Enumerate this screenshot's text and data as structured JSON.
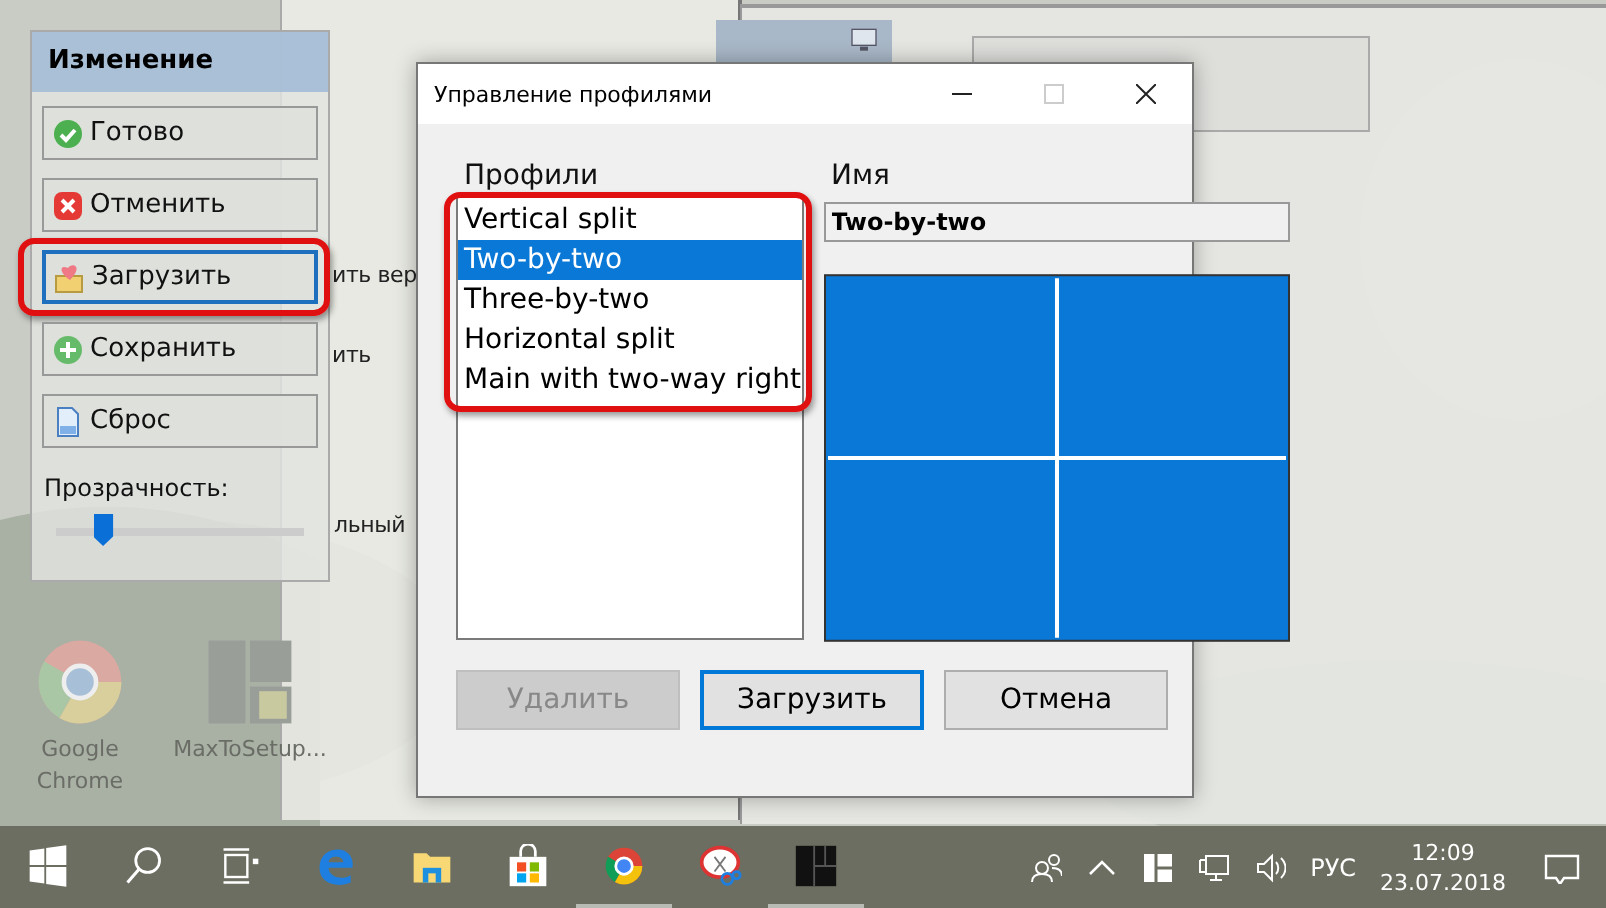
{
  "desktop": {
    "icons": [
      {
        "label": "Google Chrome",
        "kind": "chrome"
      },
      {
        "label": "MaxToSetup...",
        "kind": "maxto"
      }
    ],
    "background_window": {
      "texts": [
        "ить вер",
        "ить",
        "льный"
      ]
    }
  },
  "edit_panel": {
    "title": "Изменение",
    "buttons": [
      {
        "label": "Готово",
        "kind": "done",
        "focused": false,
        "annotated": false
      },
      {
        "label": "Отменить",
        "kind": "cancel",
        "focused": false,
        "annotated": false
      },
      {
        "label": "Загрузить",
        "kind": "load",
        "focused": true,
        "annotated": true
      },
      {
        "label": "Сохранить",
        "kind": "save",
        "focused": false,
        "annotated": false
      },
      {
        "label": "Сброс",
        "kind": "reset",
        "focused": false,
        "annotated": false
      }
    ],
    "transparency": {
      "label": "Прозрачность:",
      "level": 0.19
    }
  },
  "dialog": {
    "title": "Управление профилями",
    "profiles": {
      "label": "Профили",
      "annotated": true,
      "items": [
        {
          "label": "Vertical split",
          "selected": false
        },
        {
          "label": "Two-by-two",
          "selected": true
        },
        {
          "label": "Three-by-two",
          "selected": false
        },
        {
          "label": "Horizontal split",
          "selected": false
        },
        {
          "label": "Main with two-way right",
          "selected": false
        }
      ]
    },
    "name": {
      "label": "Имя",
      "value": "Two-by-two"
    },
    "buttons": [
      {
        "label": "Удалить",
        "disabled": true,
        "focused": false
      },
      {
        "label": "Загрузить",
        "disabled": false,
        "focused": true
      },
      {
        "label": "Отмена",
        "disabled": false,
        "focused": false
      }
    ]
  },
  "taskbar": {
    "apps": [
      {
        "kind": "edge",
        "running": false
      },
      {
        "kind": "explorer",
        "running": false
      },
      {
        "kind": "store",
        "running": false
      },
      {
        "kind": "chrome",
        "running": true
      },
      {
        "kind": "snip",
        "running": false
      },
      {
        "kind": "maxto",
        "running": true
      }
    ],
    "language": "РУС",
    "time": "12:09",
    "date": "23.07.2018"
  }
}
